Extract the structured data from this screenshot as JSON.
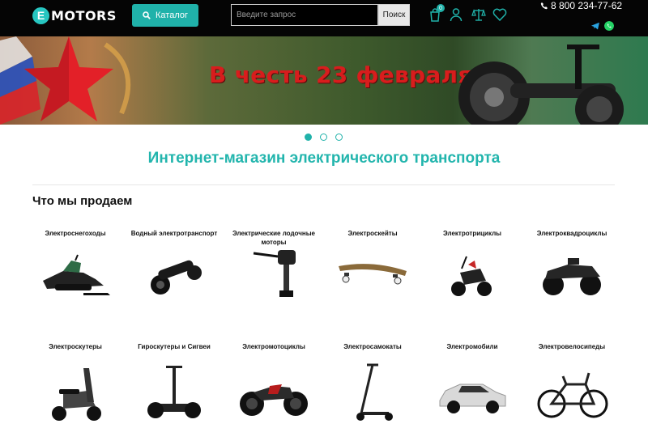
{
  "header": {
    "logo_letter": "E",
    "logo_text": "MOTORS",
    "catalog_label": "Каталог",
    "search_placeholder": "Введите запрос",
    "search_button": "Поиск",
    "cart_count": "0",
    "phone": "8 800 234-77-62",
    "icons": [
      "search-icon",
      "cart-icon",
      "user-icon",
      "scales-icon",
      "heart-icon",
      "phone-icon",
      "telegram-icon",
      "whatsapp-icon"
    ],
    "accent_color": "#20b2aa"
  },
  "banner": {
    "title": "В честь 23 февраля",
    "title_color": "#d81d1d",
    "slides": 3,
    "active_slide": 1
  },
  "main": {
    "title": "Интернет-магазин электрического транспорта",
    "section_title": "Что мы продаем"
  },
  "categories": [
    {
      "label": "Электроснегоходы",
      "icon": "snowmobile-icon"
    },
    {
      "label": "Водный электротранспорт",
      "icon": "water-transport-icon"
    },
    {
      "label": "Электрические лодочные моторы",
      "icon": "boat-motor-icon"
    },
    {
      "label": "Электроскейты",
      "icon": "skateboard-icon"
    },
    {
      "label": "Электротрициклы",
      "icon": "tricycle-icon"
    },
    {
      "label": "Электроквадроциклы",
      "icon": "atv-icon"
    },
    {
      "label": "Электроскутеры",
      "icon": "scooter-icon"
    },
    {
      "label": "Гироскутеры и Сигвеи",
      "icon": "segway-icon"
    },
    {
      "label": "Электромотоциклы",
      "icon": "motorcycle-icon"
    },
    {
      "label": "Электросамокаты",
      "icon": "kick-scooter-icon"
    },
    {
      "label": "Электромобили",
      "icon": "car-icon"
    },
    {
      "label": "Электровелосипеды",
      "icon": "bicycle-icon"
    }
  ]
}
